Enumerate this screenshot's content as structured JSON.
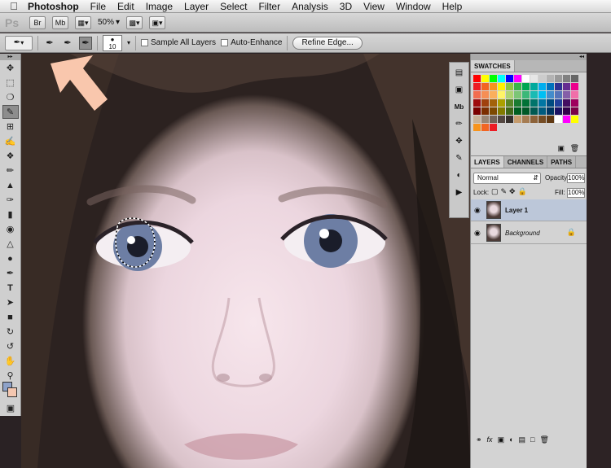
{
  "menubar": {
    "apple": "",
    "app_name": "Photoshop",
    "items": [
      "File",
      "Edit",
      "Image",
      "Layer",
      "Select",
      "Filter",
      "Analysis",
      "3D",
      "View",
      "Window",
      "Help"
    ]
  },
  "appbar": {
    "logo": "Ps",
    "bridge_label": "Br",
    "minibridge_label": "Mb",
    "zoom_value": "50%"
  },
  "options": {
    "brush_size": "10",
    "sample_all_layers": "Sample All Layers",
    "auto_enhance": "Auto-Enhance",
    "refine_edge": "Refine Edge..."
  },
  "swatches": {
    "tab_label": "SWATCHES",
    "colors": [
      "#ff0000",
      "#ffff00",
      "#00ff00",
      "#00ffff",
      "#0000ff",
      "#ff00ff",
      "#ffffff",
      "#e6e6e6",
      "#cccccc",
      "#b3b3b3",
      "#999999",
      "#808080",
      "#666666",
      "#ed1c24",
      "#f26522",
      "#f7941d",
      "#fff200",
      "#8dc63f",
      "#39b54a",
      "#00a651",
      "#00a99d",
      "#00aeef",
      "#0072bc",
      "#2e3192",
      "#662d91",
      "#ec008c",
      "#f26c4f",
      "#f68e55",
      "#fbaf5c",
      "#fff467",
      "#acd372",
      "#7cc576",
      "#3bb878",
      "#1abbb4",
      "#00bff3",
      "#438ccb",
      "#5574b9",
      "#855fa8",
      "#f06ea9",
      "#9e0b0f",
      "#a0410d",
      "#a36209",
      "#aba000",
      "#598527",
      "#1a7b30",
      "#007236",
      "#00746b",
      "#0076a3",
      "#004b80",
      "#21409a",
      "#440e62",
      "#9e005d",
      "#790000",
      "#7b2e00",
      "#7d4900",
      "#827b00",
      "#406618",
      "#005e20",
      "#005826",
      "#005952",
      "#005b7f",
      "#003663",
      "#1b1464",
      "#32004b",
      "#7b0046",
      "#c7b299",
      "#998675",
      "#736357",
      "#534741",
      "#37302d",
      "#c69c6d",
      "#a67c52",
      "#8c6239",
      "#754c24",
      "#603913",
      "#ffffff",
      "#ff00ff",
      "#ffff00",
      "#f7941d",
      "#f26522",
      "#ed1c24"
    ]
  },
  "layers_panel": {
    "tabs": [
      "LAYERS",
      "CHANNELS",
      "PATHS"
    ],
    "blend_mode": "Normal",
    "opacity_label": "Opacity:",
    "opacity_value": "100%",
    "lock_label": "Lock:",
    "fill_label": "Fill:",
    "fill_value": "100%",
    "layers": [
      {
        "name": "Layer 1",
        "selected": true
      },
      {
        "name": "Background",
        "selected": false
      }
    ]
  },
  "colors": {
    "foreground": "#8ea2c9",
    "background": "#f4c7b0",
    "arrow": "#f9c7ad"
  }
}
